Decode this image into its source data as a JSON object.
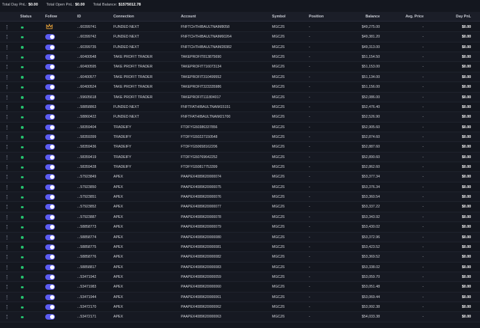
{
  "summary": {
    "day_pnl_label": "Total Day PnL:",
    "day_pnl_value": "$0.00",
    "open_pnl_label": "Total Open PnL:",
    "open_pnl_value": "$0.00",
    "balance_label": "Total Balance:",
    "balance_value": "$1575012.78"
  },
  "columns": {
    "status": "Status",
    "follow": "Follow",
    "id": "ID",
    "connection": "Connection",
    "account": "Account",
    "symbol": "Symbol",
    "position": "Position",
    "balance": "Balance",
    "avg_price": "Avg. Price",
    "day_pnl": "Day PnL"
  },
  "colors": {
    "status_active": "#25c26e",
    "toggle_on": "#5b5bf0",
    "crown": "#e8a33a"
  },
  "rows": [
    {
      "id": "...60399741",
      "connection": "FUNDED NEXT",
      "account": "FNFTCHTHIBAULTNAIM8058",
      "symbol": "MGCZ6",
      "position": "-",
      "balance": "$49,275.00",
      "avg_price": "-",
      "day_pnl": "$0.00",
      "leader": true
    },
    {
      "id": "...60399742",
      "connection": "FUNDED NEXT",
      "account": "FNFTCHTHIBAULTNAIM60264",
      "symbol": "MGCZ6",
      "position": "-",
      "balance": "$49,381.20",
      "avg_price": "-",
      "day_pnl": "$0.00"
    },
    {
      "id": "...60399735",
      "connection": "FUNDED NEXT",
      "account": "FNFTCHTHIBAULTNAIM28382",
      "symbol": "MGCZ6",
      "position": "-",
      "balance": "$49,313.00",
      "avg_price": "-",
      "day_pnl": "$0.00"
    },
    {
      "id": "...60400548",
      "connection": "TAKE PROFIT TRADER",
      "account": "TAKEPROFIT813875690",
      "symbol": "MGCZ6",
      "position": "-",
      "balance": "$51,154.50",
      "avg_price": "-",
      "day_pnl": "$0.00"
    },
    {
      "id": "...60400595",
      "connection": "TAKE PROFIT TRADER",
      "account": "TAKEPROFIT716073134",
      "symbol": "MGCZ6",
      "position": "-",
      "balance": "$51,153.00",
      "avg_price": "-",
      "day_pnl": "$0.00"
    },
    {
      "id": "...60400577",
      "connection": "TAKE PROFIT TRADER",
      "account": "TAKEPROFIT310499552",
      "symbol": "MGCZ6",
      "position": "-",
      "balance": "$51,134.00",
      "avg_price": "-",
      "day_pnl": "$0.00"
    },
    {
      "id": "...60400524",
      "connection": "TAKE PROFIT TRADER",
      "account": "TAKEPROFIT323335986",
      "symbol": "MGCZ6",
      "position": "-",
      "balance": "$51,156.00",
      "avg_price": "-",
      "day_pnl": "$0.00"
    },
    {
      "id": "...59605618",
      "connection": "TAKE PROFIT TRADER",
      "account": "TAKEPROFIT111804017",
      "symbol": "MGCZ6",
      "position": "-",
      "balance": "$52,086.00",
      "avg_price": "-",
      "day_pnl": "$0.00"
    },
    {
      "id": "...58858863",
      "connection": "FUNDED NEXT",
      "account": "FNFTFATHIBAULTNAIM15151",
      "symbol": "MGCZ6",
      "position": "-",
      "balance": "$52,476.40",
      "avg_price": "-",
      "day_pnl": "$0.00"
    },
    {
      "id": "...58860422",
      "connection": "FUNDED NEXT",
      "account": "FNFTFATHIBAULTNAIM21700",
      "symbol": "MGCZ6",
      "position": "-",
      "balance": "$52,526.90",
      "avg_price": "-",
      "day_pnl": "$0.00"
    },
    {
      "id": "...58359404",
      "connection": "TRADEIFY",
      "account": "FTDFYG50386337856",
      "symbol": "MGCZ6",
      "position": "-",
      "balance": "$52,905.60",
      "avg_price": "-",
      "day_pnl": "$0.00"
    },
    {
      "id": "...58359399",
      "connection": "TRADEIFY",
      "account": "FTDFYG50227150548",
      "symbol": "MGCZ6",
      "position": "-",
      "balance": "$52,874.60",
      "avg_price": "-",
      "day_pnl": "$0.00"
    },
    {
      "id": "...58359436",
      "connection": "TRADEIFY",
      "account": "FTDFYG50658162206",
      "symbol": "MGCZ6",
      "position": "-",
      "balance": "$52,887.60",
      "avg_price": "-",
      "day_pnl": "$0.00"
    },
    {
      "id": "...58359419",
      "connection": "TRADEIFY",
      "account": "FTDFYG50769642252",
      "symbol": "MGCZ6",
      "position": "-",
      "balance": "$52,890.60",
      "avg_price": "-",
      "day_pnl": "$0.00"
    },
    {
      "id": "...58359428",
      "connection": "TRADEIFY",
      "account": "FTDFYG50817753399",
      "symbol": "MGCZ6",
      "position": "-",
      "balance": "$52,862.60",
      "avg_price": "-",
      "day_pnl": "$0.00"
    },
    {
      "id": "...57923849",
      "connection": "APEX",
      "account": "PAAPEX4089620000074",
      "symbol": "MGCZ6",
      "position": "-",
      "balance": "$53,377.34",
      "avg_price": "-",
      "day_pnl": "$0.00"
    },
    {
      "id": "...57923850",
      "connection": "APEX",
      "account": "PAAPEX4089620000075",
      "symbol": "MGCZ6",
      "position": "-",
      "balance": "$53,376.34",
      "avg_price": "-",
      "day_pnl": "$0.00"
    },
    {
      "id": "...57923851",
      "connection": "APEX",
      "account": "PAAPEX4089620000076",
      "symbol": "MGCZ6",
      "position": "-",
      "balance": "$53,360.54",
      "avg_price": "-",
      "day_pnl": "$0.00"
    },
    {
      "id": "...57923852",
      "connection": "APEX",
      "account": "PAAPEX4089620000077",
      "symbol": "MGCZ6",
      "position": "-",
      "balance": "$53,337.22",
      "avg_price": "-",
      "day_pnl": "$0.00"
    },
    {
      "id": "...57923887",
      "connection": "APEX",
      "account": "PAAPEX4089620000078",
      "symbol": "MGCZ6",
      "position": "-",
      "balance": "$53,343.92",
      "avg_price": "-",
      "day_pnl": "$0.00"
    },
    {
      "id": "...58858773",
      "connection": "APEX",
      "account": "PAAPEX4089620000079",
      "symbol": "MGCZ6",
      "position": "-",
      "balance": "$53,430.02",
      "avg_price": "-",
      "day_pnl": "$0.00"
    },
    {
      "id": "...58858774",
      "connection": "APEX",
      "account": "PAAPEX4089620000080",
      "symbol": "MGCZ6",
      "position": "-",
      "balance": "$53,372.96",
      "avg_price": "-",
      "day_pnl": "$0.00"
    },
    {
      "id": "...58858775",
      "connection": "APEX",
      "account": "PAAPEX4089620000081",
      "symbol": "MGCZ6",
      "position": "-",
      "balance": "$53,423.52",
      "avg_price": "-",
      "day_pnl": "$0.00"
    },
    {
      "id": "...58858776",
      "connection": "APEX",
      "account": "PAAPEX4089620000082",
      "symbol": "MGCZ6",
      "position": "-",
      "balance": "$53,369.52",
      "avg_price": "-",
      "day_pnl": "$0.00"
    },
    {
      "id": "...58858817",
      "connection": "APEX",
      "account": "PAAPEX4089620000083",
      "symbol": "MGCZ6",
      "position": "-",
      "balance": "$53,338.02",
      "avg_price": "-",
      "day_pnl": "$0.00"
    },
    {
      "id": "...53471942",
      "connection": "APEX",
      "account": "PAAPEX4089620000059",
      "symbol": "MGCZ6",
      "position": "-",
      "balance": "$53,059.70",
      "avg_price": "-",
      "day_pnl": "$0.00"
    },
    {
      "id": "...53471983",
      "connection": "APEX",
      "account": "PAAPEX4089620000060",
      "symbol": "MGCZ6",
      "position": "-",
      "balance": "$53,051.48",
      "avg_price": "-",
      "day_pnl": "$0.00"
    },
    {
      "id": "...53471944",
      "connection": "APEX",
      "account": "PAAPEX4089620000061",
      "symbol": "MGCZ6",
      "position": "-",
      "balance": "$53,069.44",
      "avg_price": "-",
      "day_pnl": "$0.00"
    },
    {
      "id": "...53472170",
      "connection": "APEX",
      "account": "PAAPEX4089620000062",
      "symbol": "MGCZ6",
      "position": "-",
      "balance": "$53,992.38",
      "avg_price": "-",
      "day_pnl": "$0.00"
    },
    {
      "id": "...53472171",
      "connection": "APEX",
      "account": "PAAPEX4089620000063",
      "symbol": "MGCZ6",
      "position": "-",
      "balance": "$54,033.38",
      "avg_price": "-",
      "day_pnl": "$0.00"
    }
  ]
}
